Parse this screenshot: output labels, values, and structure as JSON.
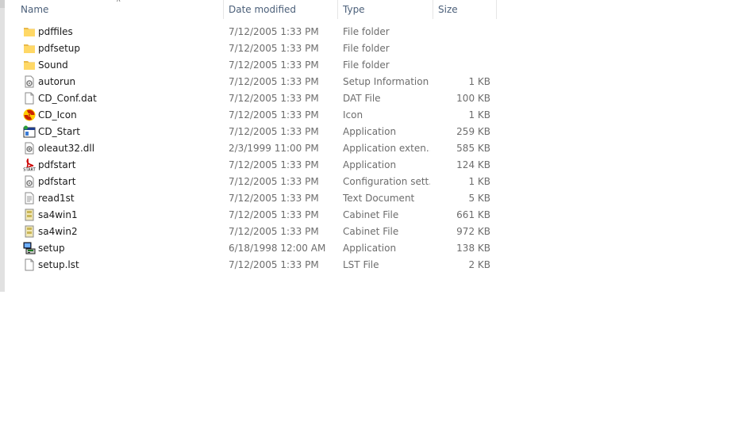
{
  "columns": {
    "name": "Name",
    "date": "Date modified",
    "type": "Type",
    "size": "Size"
  },
  "files": [
    {
      "name": "pdffiles",
      "date": "7/12/2005 1:33 PM",
      "type": "File folder",
      "size": "",
      "icon": "folder-icon"
    },
    {
      "name": "pdfsetup",
      "date": "7/12/2005 1:33 PM",
      "type": "File folder",
      "size": "",
      "icon": "folder-icon"
    },
    {
      "name": "Sound",
      "date": "7/12/2005 1:33 PM",
      "type": "File folder",
      "size": "",
      "icon": "folder-icon"
    },
    {
      "name": "autorun",
      "date": "7/12/2005 1:33 PM",
      "type": "Setup Information",
      "size": "1 KB",
      "icon": "setup-info-icon"
    },
    {
      "name": "CD_Conf.dat",
      "date": "7/12/2005 1:33 PM",
      "type": "DAT File",
      "size": "100 KB",
      "icon": "blank-file-icon"
    },
    {
      "name": "CD_Icon",
      "date": "7/12/2005 1:33 PM",
      "type": "Icon",
      "size": "1 KB",
      "icon": "radiation-icon"
    },
    {
      "name": "CD_Start",
      "date": "7/12/2005 1:33 PM",
      "type": "Application",
      "size": "259 KB",
      "icon": "application-window-icon"
    },
    {
      "name": "oleaut32.dll",
      "date": "2/3/1999 11:00 PM",
      "type": "Application exten...",
      "size": "585 KB",
      "icon": "dll-gear-icon"
    },
    {
      "name": "pdfstart",
      "date": "7/12/2005 1:33 PM",
      "type": "Application",
      "size": "124 KB",
      "icon": "pdf-start-icon"
    },
    {
      "name": "pdfstart",
      "date": "7/12/2005 1:33 PM",
      "type": "Configuration sett...",
      "size": "1 KB",
      "icon": "config-gear-icon"
    },
    {
      "name": "read1st",
      "date": "7/12/2005 1:33 PM",
      "type": "Text Document",
      "size": "5 KB",
      "icon": "text-document-icon"
    },
    {
      "name": "sa4win1",
      "date": "7/12/2005 1:33 PM",
      "type": "Cabinet File",
      "size": "661 KB",
      "icon": "cabinet-icon"
    },
    {
      "name": "sa4win2",
      "date": "7/12/2005 1:33 PM",
      "type": "Cabinet File",
      "size": "972 KB",
      "icon": "cabinet-icon"
    },
    {
      "name": "setup",
      "date": "6/18/1998 12:00 AM",
      "type": "Application",
      "size": "138 KB",
      "icon": "setup-computer-icon"
    },
    {
      "name": "setup.lst",
      "date": "7/12/2005 1:33 PM",
      "type": "LST File",
      "size": "2 KB",
      "icon": "blank-file-icon"
    }
  ],
  "colors": {
    "header_text": "#4c607a",
    "detail_text": "#6d6d6d",
    "folder": "#ffd866",
    "hover": "#e5f3ff"
  }
}
